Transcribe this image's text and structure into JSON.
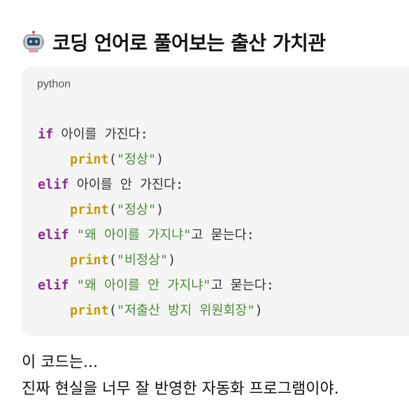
{
  "heading": {
    "icon": "robot-icon",
    "title": "코딩 언어로 풀어보는 출산 가치관"
  },
  "code_block": {
    "language": "python",
    "lines": {
      "l1": {
        "kw": "if",
        "text": " 아이를 가진다:"
      },
      "l2": {
        "fn": "print",
        "open": "(",
        "str": "\"정상\"",
        "close": ")"
      },
      "l3": {
        "kw": "elif",
        "text": " 아이를 안 가진다:"
      },
      "l4": {
        "fn": "print",
        "open": "(",
        "str": "\"정상\"",
        "close": ")"
      },
      "l5": {
        "kw": "elif",
        "str": " \"왜 아이를 가지냐\"",
        "text": "고 묻는다:"
      },
      "l6": {
        "fn": "print",
        "open": "(",
        "str": "\"비정상\"",
        "close": ")"
      },
      "l7": {
        "kw": "elif",
        "str": " \"왜 아이를 안 가지냐\"",
        "text": "고 묻는다:"
      },
      "l8": {
        "fn": "print",
        "open": "(",
        "str": "\"저출산 방지 위원회장\"",
        "close": ")"
      }
    }
  },
  "body": {
    "line1": "이 코드는...",
    "line2": "진짜 현실을 너무 잘 반영한 자동화 프로그램이야."
  },
  "colors": {
    "keyword": "#8b2c8f",
    "function": "#c39a0e",
    "string": "#4d8a3a",
    "code_background": "#f5f5f5"
  }
}
